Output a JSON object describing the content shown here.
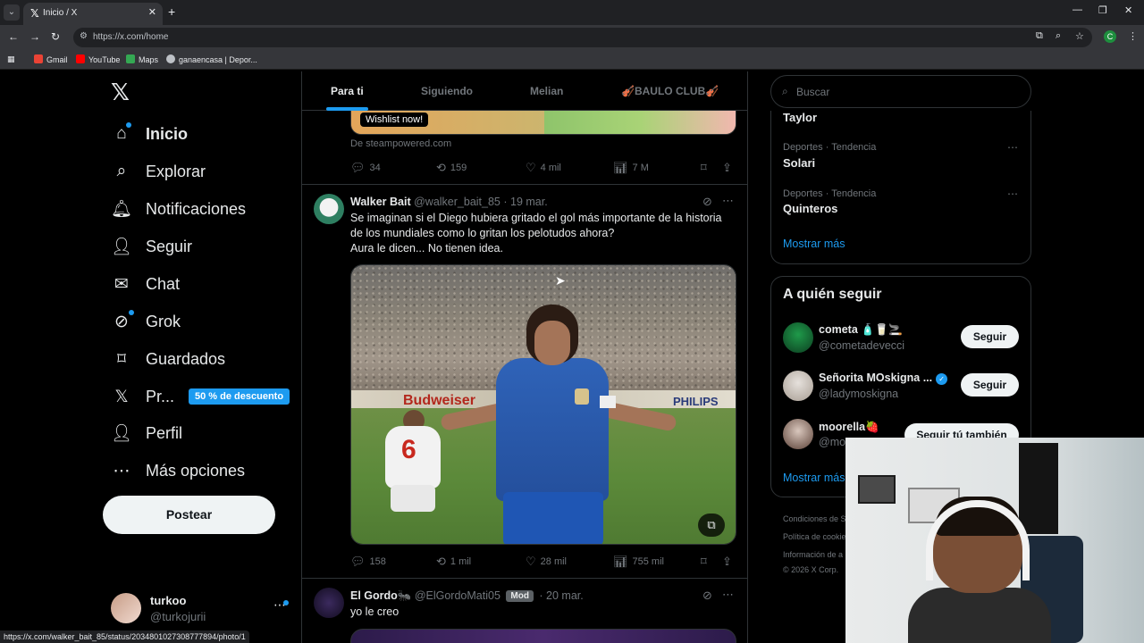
{
  "browser": {
    "tab_title": "Inicio / X",
    "tab_favicon": "𝕏",
    "url": "https://x.com/home",
    "profile_initial": "C",
    "bookmarks": [
      "Gmail",
      "YouTube",
      "Maps",
      "ganaencasa | Depor..."
    ],
    "status_url": "https://x.com/walker_bait_85/status/2034801027308777894/photo/1"
  },
  "nav": {
    "logo": "𝕏",
    "items": [
      {
        "label": "Inicio",
        "icon": "home-icon"
      },
      {
        "label": "Explorar",
        "icon": "search-icon"
      },
      {
        "label": "Notificaciones",
        "icon": "bell-icon"
      },
      {
        "label": "Seguir",
        "icon": "follow-icon"
      },
      {
        "label": "Chat",
        "icon": "mail-icon"
      },
      {
        "label": "Grok",
        "icon": "grok-icon"
      },
      {
        "label": "Guardados",
        "icon": "bookmark-icon"
      },
      {
        "label": "Pr...",
        "icon": "x-premium-icon"
      },
      {
        "label": "Perfil",
        "icon": "profile-icon"
      },
      {
        "label": "Más opciones",
        "icon": "more-options-icon"
      }
    ],
    "promo": "50 % de descuento",
    "post_button": "Postear",
    "account": {
      "name": "turkoo",
      "handle": "@turkojurii"
    }
  },
  "timeline": {
    "tabs": [
      "Para ti",
      "Siguiendo",
      "Melian",
      "🎻BAULO CLUB🎻"
    ],
    "prev_post": {
      "wishlist": "Wishlist now!",
      "source": "De steampowered.com",
      "replies": "34",
      "reposts": "159",
      "likes": "4 mil",
      "views": "7 M"
    },
    "post": {
      "name": "Walker Bait",
      "handle": "@walker_bait_85",
      "date": "· 19 mar.",
      "text_1": "Se imaginan si el Diego hubiera gritado el gol más importante de la historia de los mundiales como lo gritan los pelotudos ahora?",
      "text_2": "Aura le dicen... No tienen idea.",
      "media_ad_1": "Budweiser",
      "media_ad_2": "PHILIPS",
      "media_number": "6",
      "replies": "158",
      "reposts": "1 mil",
      "likes": "28 mil",
      "views": "755 mil"
    },
    "next_post": {
      "name": "El Gordo🐜",
      "handle": "@ElGordoMati05",
      "badge": "Mod",
      "date": "· 20 mar.",
      "text": "yo le creo"
    }
  },
  "sidebar": {
    "search_placeholder": "Buscar",
    "trends": [
      {
        "meta": "",
        "name": "Taylor"
      },
      {
        "meta": "Deportes · Tendencia",
        "name": "Solari"
      },
      {
        "meta": "Deportes · Tendencia",
        "name": "Quinteros"
      }
    ],
    "trends_show_more": "Mostrar más",
    "who_to_follow_title": "A quién seguir",
    "suggestions": [
      {
        "name": "cometa 🧴🥛🚬",
        "handle": "@cometadevecci",
        "button": "Seguir"
      },
      {
        "name": "Señorita MOskigna ...",
        "handle": "@ladymoskigna",
        "button": "Seguir",
        "verified": true
      },
      {
        "name": "moorella🍓",
        "handle": "@mo",
        "button": "Seguir tú también"
      }
    ],
    "follow_show_more": "Mostrar más",
    "footer": [
      "Condiciones de S",
      "Política de cookie",
      "Información de a",
      "© 2026 X Corp."
    ]
  },
  "colors": {
    "accent": "#1d9bf0",
    "background": "#000000",
    "border": "#2f3336",
    "muted": "#71767b"
  }
}
